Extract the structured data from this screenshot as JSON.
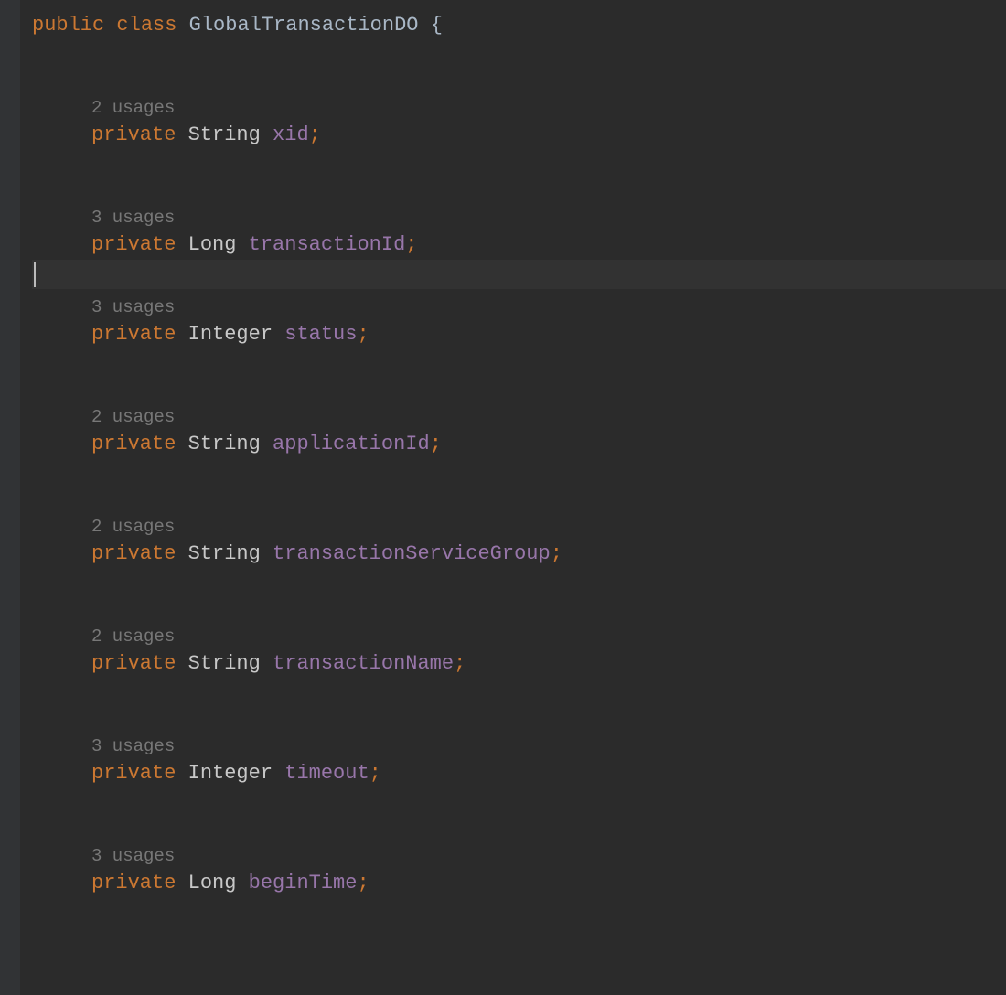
{
  "declaration": {
    "modifier": "public",
    "keyword": "class",
    "name": "GlobalTransactionDO",
    "open_brace": "{"
  },
  "fields": [
    {
      "usages": "2 usages",
      "modifier": "private",
      "type": "String",
      "name": "xid",
      "semi": ";"
    },
    {
      "usages": "3 usages",
      "modifier": "private",
      "type": "Long",
      "name": "transactionId",
      "semi": ";"
    },
    {
      "usages": "3 usages",
      "modifier": "private",
      "type": "Integer",
      "name": "status",
      "semi": ";"
    },
    {
      "usages": "2 usages",
      "modifier": "private",
      "type": "String",
      "name": "applicationId",
      "semi": ";"
    },
    {
      "usages": "2 usages",
      "modifier": "private",
      "type": "String",
      "name": "transactionServiceGroup",
      "semi": ";"
    },
    {
      "usages": "2 usages",
      "modifier": "private",
      "type": "String",
      "name": "transactionName",
      "semi": ";"
    },
    {
      "usages": "3 usages",
      "modifier": "private",
      "type": "Integer",
      "name": "timeout",
      "semi": ";"
    },
    {
      "usages": "3 usages",
      "modifier": "private",
      "type": "Long",
      "name": "beginTime",
      "semi": ";"
    }
  ],
  "caret_line_index": 1
}
